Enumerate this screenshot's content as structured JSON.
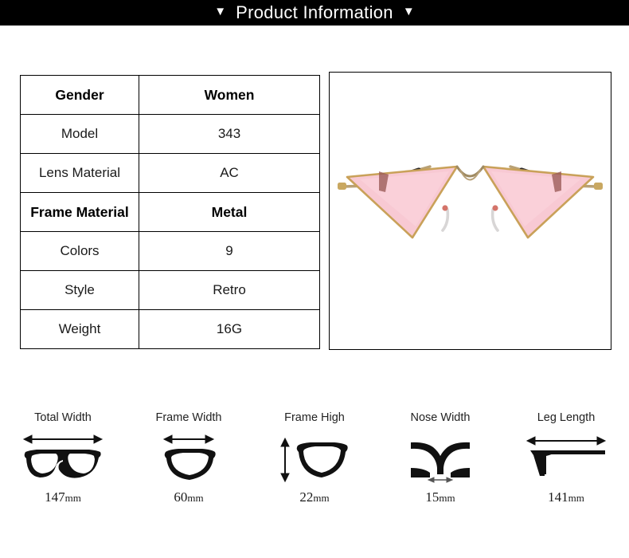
{
  "header": {
    "title": "Product Information",
    "left_marker": "▼",
    "right_marker": "▼",
    "background_color": "#000000",
    "text_color": "#ffffff"
  },
  "spec_table": {
    "rows": [
      {
        "label": "Gender",
        "value": "Women",
        "emphasis": true
      },
      {
        "label": "Model",
        "value": "343",
        "emphasis": false
      },
      {
        "label": "Lens Material",
        "value": "AC",
        "emphasis": false
      },
      {
        "label": "Frame Material",
        "value": "Metal",
        "emphasis": true
      },
      {
        "label": "Colors",
        "value": "9",
        "emphasis": false
      },
      {
        "label": "Style",
        "value": "Retro",
        "emphasis": false
      },
      {
        "label": "Weight",
        "value": "16G",
        "emphasis": false
      }
    ]
  },
  "product_image": {
    "alt": "cat-eye sunglasses with pink triangular lenses and gold metal frame",
    "lens_color": "#f8c9d3",
    "frame_color": "#c9a86a",
    "temple_color": "#2b2b2b",
    "background_color": "#ffffff"
  },
  "measurements": [
    {
      "label": "Total Width",
      "value": "147",
      "unit": "mm",
      "icon": "full-glasses-horizontal-arrow-icon"
    },
    {
      "label": "Frame Width",
      "value": "60",
      "unit": "mm",
      "icon": "single-lens-horizontal-arrow-icon"
    },
    {
      "label": "Frame High",
      "value": "22",
      "unit": "mm",
      "icon": "single-lens-vertical-arrow-icon"
    },
    {
      "label": "Nose Width",
      "value": "15",
      "unit": "mm",
      "icon": "nose-bridge-arrow-icon"
    },
    {
      "label": "Leg Length",
      "value": "141",
      "unit": "mm",
      "icon": "temple-arm-arrow-icon"
    }
  ]
}
